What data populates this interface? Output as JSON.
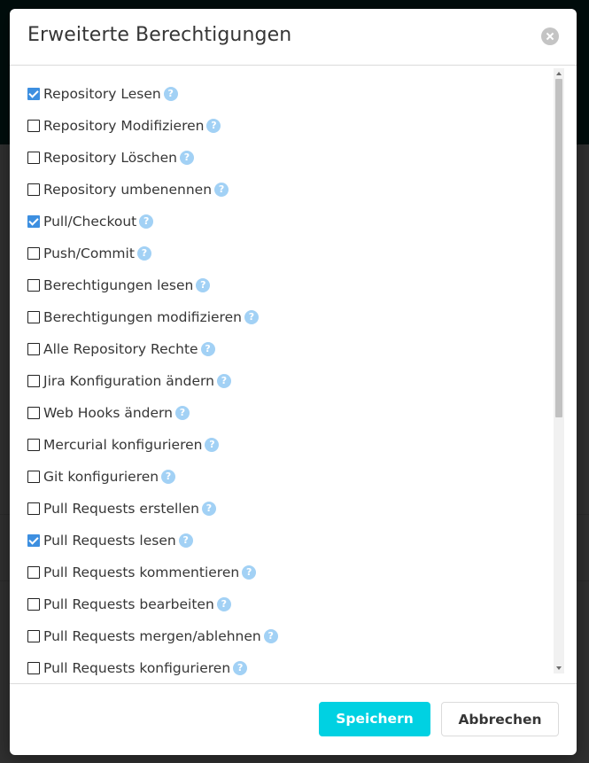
{
  "modal": {
    "title": "Erweiterte Berechtigungen",
    "close_icon": "close-icon",
    "permissions": [
      {
        "label": "Repository Lesen",
        "checked": true
      },
      {
        "label": "Repository Modifizieren",
        "checked": false
      },
      {
        "label": "Repository Löschen",
        "checked": false
      },
      {
        "label": "Repository umbenennen",
        "checked": false
      },
      {
        "label": "Pull/Checkout",
        "checked": true
      },
      {
        "label": "Push/Commit",
        "checked": false
      },
      {
        "label": "Berechtigungen lesen",
        "checked": false
      },
      {
        "label": "Berechtigungen modifizieren",
        "checked": false
      },
      {
        "label": "Alle Repository Rechte",
        "checked": false
      },
      {
        "label": "Jira Konfiguration ändern",
        "checked": false
      },
      {
        "label": "Web Hooks ändern",
        "checked": false
      },
      {
        "label": "Mercurial konfigurieren",
        "checked": false
      },
      {
        "label": "Git konfigurieren",
        "checked": false
      },
      {
        "label": "Pull Requests erstellen",
        "checked": false
      },
      {
        "label": "Pull Requests lesen",
        "checked": true
      },
      {
        "label": "Pull Requests kommentieren",
        "checked": false
      },
      {
        "label": "Pull Requests bearbeiten",
        "checked": false
      },
      {
        "label": "Pull Requests mergen/ablehnen",
        "checked": false
      },
      {
        "label": "Pull Requests konfigurieren",
        "checked": false
      }
    ],
    "help_icon": "question-circle-icon",
    "help_glyph": "?",
    "save_label": "Speichern",
    "cancel_label": "Abbrechen"
  },
  "colors": {
    "primary_button": "#00d1e2",
    "checkbox_checked": "#3d8fe0",
    "help_icon": "#a2d1f5"
  }
}
